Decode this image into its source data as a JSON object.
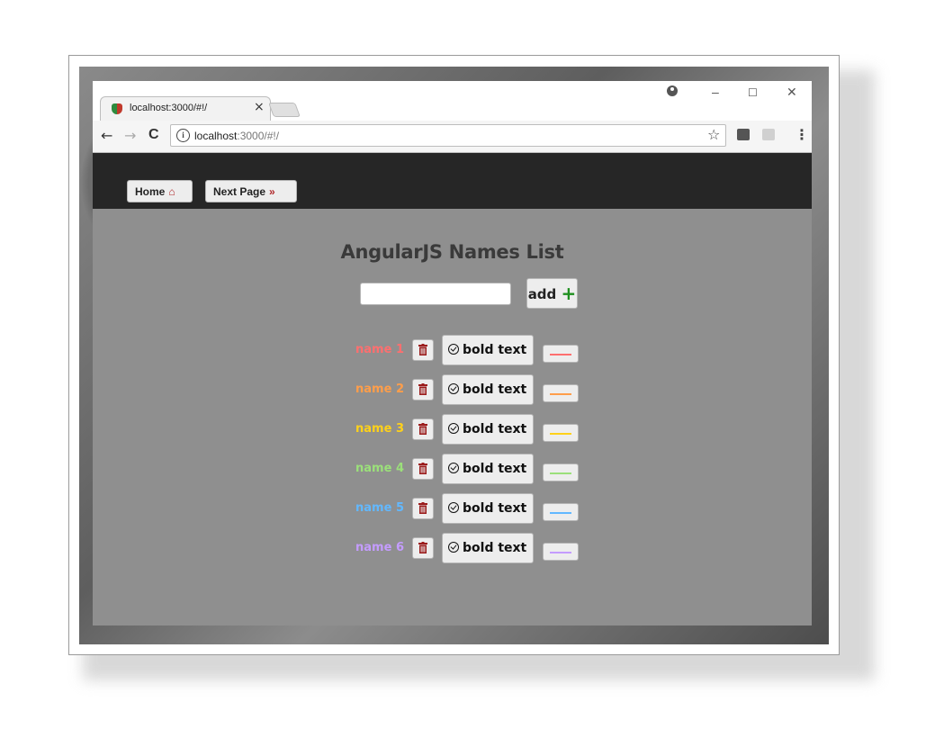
{
  "browser": {
    "tab_title": "localhost:3000/#!/",
    "tab_close": "×",
    "window_controls": {
      "minimize": "–",
      "maximize": "☐",
      "close": "✕"
    },
    "nav": {
      "back": "←",
      "forward": "→",
      "reload": "C"
    },
    "url_host": "localhost",
    "url_path": ":3000/#!/",
    "star": "☆",
    "menu": "⋮"
  },
  "navbar": {
    "home_label": "Home",
    "home_icon": "home-icon",
    "next_label": "Next Page",
    "next_icon": "double-chevron-right-icon"
  },
  "main": {
    "title": "AngularJS Names List",
    "input_value": "",
    "add_label": "add",
    "add_icon": "+"
  },
  "names": [
    {
      "label": "name 1",
      "color": "#ff6f6f",
      "button_text": "bold text"
    },
    {
      "label": "name 2",
      "color": "#ff9e4a",
      "button_text": "bold text"
    },
    {
      "label": "name 3",
      "color": "#ffd11a",
      "button_text": "bold text"
    },
    {
      "label": "name 4",
      "color": "#9be07a",
      "button_text": "bold text"
    },
    {
      "label": "name 5",
      "color": "#62b8ff",
      "button_text": "bold text"
    },
    {
      "label": "name 6",
      "color": "#c49cff",
      "button_text": "bold text"
    }
  ],
  "colors": {
    "navbar_bg": "#262626",
    "page_bg": "#8f8f8f",
    "accent_red": "#b0282a",
    "add_green": "#1e8f1e"
  }
}
